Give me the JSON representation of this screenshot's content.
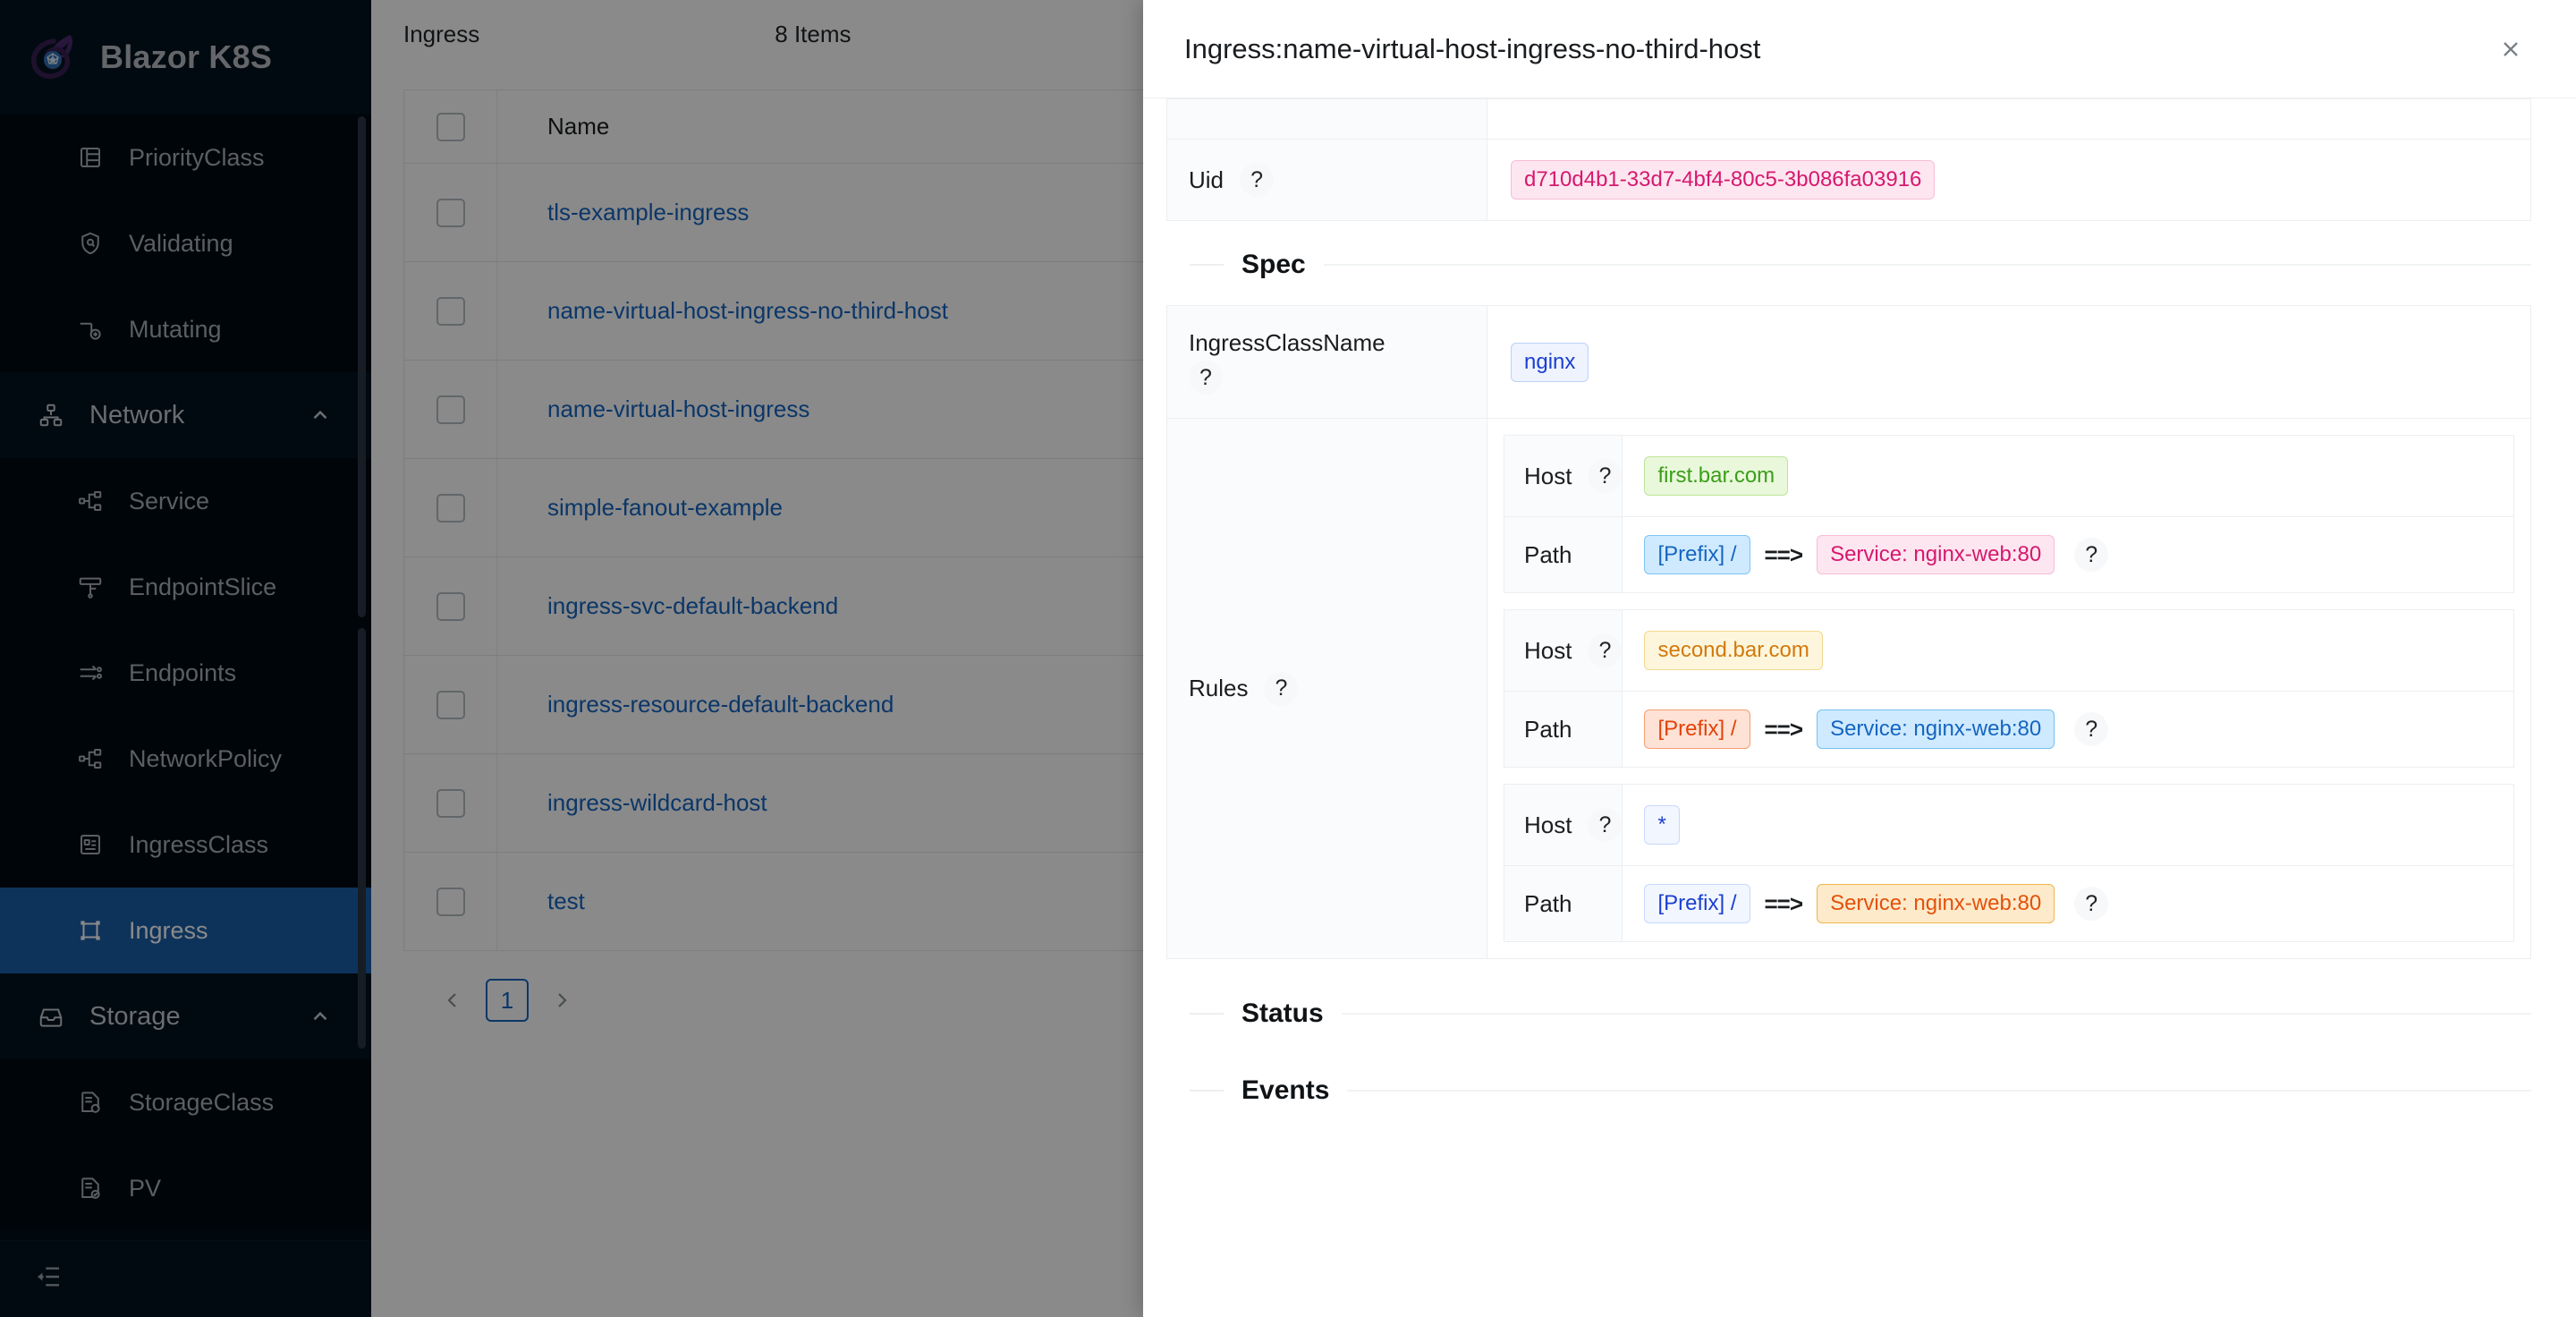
{
  "app": {
    "title": "Blazor K8S",
    "logo_icon": "blazor-k8s-logo"
  },
  "sidebar": {
    "items": [
      {
        "label": "PriorityClass",
        "icon": "priority-class-icon",
        "type": "item",
        "active": false
      },
      {
        "label": "Validating",
        "icon": "shield-check-icon",
        "type": "item",
        "active": false
      },
      {
        "label": "Mutating",
        "icon": "mutating-icon",
        "type": "item",
        "active": false
      },
      {
        "label": "Network",
        "icon": "network-icon",
        "type": "group",
        "active": false,
        "expanded": true
      },
      {
        "label": "Service",
        "icon": "service-icon",
        "type": "item",
        "active": false
      },
      {
        "label": "EndpointSlice",
        "icon": "endpoint-slice-icon",
        "type": "item",
        "active": false
      },
      {
        "label": "Endpoints",
        "icon": "endpoints-icon",
        "type": "item",
        "active": false
      },
      {
        "label": "NetworkPolicy",
        "icon": "network-policy-icon",
        "type": "item",
        "active": false
      },
      {
        "label": "IngressClass",
        "icon": "ingress-class-icon",
        "type": "item",
        "active": false
      },
      {
        "label": "Ingress",
        "icon": "ingress-icon",
        "type": "item",
        "active": true
      },
      {
        "label": "Storage",
        "icon": "storage-icon",
        "type": "group",
        "active": false,
        "expanded": true
      },
      {
        "label": "StorageClass",
        "icon": "storage-class-icon",
        "type": "item",
        "active": false
      },
      {
        "label": "PV",
        "icon": "pv-icon",
        "type": "item",
        "active": false
      }
    ],
    "collapse_icon": "collapse-sidebar-icon"
  },
  "list": {
    "title": "Ingress",
    "count_label": "8 Items",
    "column_header": "Name",
    "rows": [
      {
        "name": "tls-example-ingress"
      },
      {
        "name": "name-virtual-host-ingress-no-third-host"
      },
      {
        "name": "name-virtual-host-ingress"
      },
      {
        "name": "simple-fanout-example"
      },
      {
        "name": "ingress-svc-default-backend"
      },
      {
        "name": "ingress-resource-default-backend"
      },
      {
        "name": "ingress-wildcard-host"
      },
      {
        "name": "test"
      }
    ],
    "pagination": {
      "prev_icon": "chevron-left-icon",
      "page": "1",
      "next_icon": "chevron-right-icon"
    }
  },
  "modal": {
    "title": "Ingress:name-virtual-host-ingress-no-third-host",
    "close_icon": "close-icon",
    "help_glyph": "?",
    "metadata": {
      "uid_label": "Uid",
      "uid_value": "d710d4b1-33d7-4bf4-80c5-3b086fa03916"
    },
    "spec": {
      "section_label": "Spec",
      "ingress_class_name_label": "IngressClassName",
      "ingress_class_name_value": "nginx",
      "rules_label": "Rules",
      "host_label": "Host",
      "path_label": "Path",
      "arrow": "==>",
      "rules": [
        {
          "host": "first.bar.com",
          "host_style": "green",
          "path": "[Prefix] /",
          "path_style": "lblue",
          "backend": "Service: nginx-web:80",
          "backend_style": "pink"
        },
        {
          "host": "second.bar.com",
          "host_style": "yellow",
          "path": "[Prefix] /",
          "path_style": "orange",
          "backend": "Service: nginx-web:80",
          "backend_style": "skyb"
        },
        {
          "host": "*",
          "host_style": "pale",
          "path": "[Prefix] /",
          "path_style": "pale",
          "backend": "Service: nginx-web:80",
          "backend_style": "amber"
        }
      ]
    },
    "status": {
      "section_label": "Status"
    },
    "events": {
      "section_label": "Events"
    }
  },
  "colors": {
    "sidebar_bg": "#010f1a",
    "active_nav": "#1a5fa8",
    "link": "#1565c0",
    "accent_pink": "#d6186e",
    "accent_green": "#3a9e19",
    "accent_orange": "#e4510a"
  }
}
